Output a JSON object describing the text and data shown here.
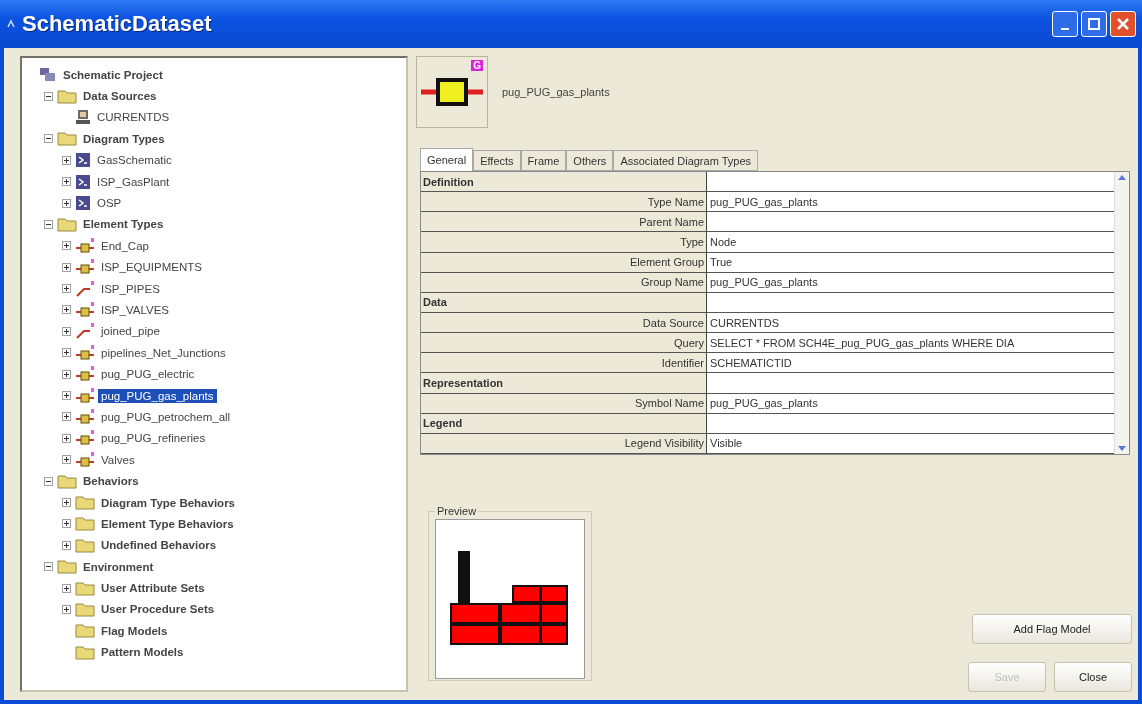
{
  "window": {
    "title": "SchematicDataset"
  },
  "tree": [
    {
      "label": "Schematic Project",
      "kind": "project",
      "selected": false,
      "children": [
        {
          "label": "Data Sources",
          "kind": "category",
          "expanded": true,
          "selected": false,
          "children": [
            {
              "label": "CURRENTDS",
              "kind": "datasource",
              "selected": false
            }
          ]
        },
        {
          "label": "Diagram Types",
          "kind": "category",
          "expanded": true,
          "selected": false,
          "children": [
            {
              "label": "GasSchematic",
              "kind": "diagram",
              "expanded": false,
              "selected": false
            },
            {
              "label": "ISP_GasPlant",
              "kind": "diagram",
              "expanded": false,
              "selected": false
            },
            {
              "label": "OSP",
              "kind": "diagram",
              "expanded": false,
              "selected": false
            }
          ]
        },
        {
          "label": "Element Types",
          "kind": "category",
          "expanded": true,
          "selected": false,
          "children": [
            {
              "label": "End_Cap",
              "kind": "node",
              "expanded": false,
              "selected": false
            },
            {
              "label": "ISP_EQUIPMENTS",
              "kind": "node",
              "expanded": false,
              "selected": false
            },
            {
              "label": "ISP_PIPES",
              "kind": "link",
              "expanded": false,
              "selected": false
            },
            {
              "label": "ISP_VALVES",
              "kind": "node",
              "expanded": false,
              "selected": false
            },
            {
              "label": "joined_pipe",
              "kind": "link",
              "expanded": false,
              "selected": false
            },
            {
              "label": "pipelines_Net_Junctions",
              "kind": "node",
              "expanded": false,
              "selected": false
            },
            {
              "label": "pug_PUG_electric",
              "kind": "node",
              "expanded": false,
              "selected": false
            },
            {
              "label": "pug_PUG_gas_plants",
              "kind": "node",
              "expanded": false,
              "selected": true
            },
            {
              "label": "pug_PUG_petrochem_all",
              "kind": "node",
              "expanded": false,
              "selected": false
            },
            {
              "label": "pug_PUG_refineries",
              "kind": "node",
              "expanded": false,
              "selected": false
            },
            {
              "label": "Valves",
              "kind": "node",
              "expanded": false,
              "selected": false
            }
          ]
        },
        {
          "label": "Behaviors",
          "kind": "category",
          "expanded": true,
          "selected": false,
          "children": [
            {
              "label": "Diagram Type Behaviors",
              "kind": "folder",
              "expanded": false,
              "selected": false
            },
            {
              "label": "Element Type Behaviors",
              "kind": "folder",
              "expanded": false,
              "selected": false
            },
            {
              "label": "Undefined Behaviors",
              "kind": "folder",
              "expanded": false,
              "selected": false
            }
          ]
        },
        {
          "label": "Environment",
          "kind": "category",
          "expanded": true,
          "selected": false,
          "children": [
            {
              "label": "User Attribute Sets",
              "kind": "folder",
              "expanded": false,
              "selected": false
            },
            {
              "label": "User Procedure Sets",
              "kind": "folder",
              "expanded": false,
              "selected": false
            },
            {
              "label": "Flag Models",
              "kind": "folder",
              "selected": false
            },
            {
              "label": "Pattern Models",
              "kind": "folder",
              "selected": false
            }
          ]
        }
      ]
    }
  ],
  "header": {
    "badge": "G",
    "name": "pug_PUG_gas_plants"
  },
  "tabs": [
    {
      "label": "General",
      "selected": true
    },
    {
      "label": "Effects",
      "selected": false
    },
    {
      "label": "Frame",
      "selected": false
    },
    {
      "label": "Others",
      "selected": false
    },
    {
      "label": "Associated Diagram Types",
      "selected": false
    }
  ],
  "properties": [
    {
      "kind": "section",
      "label": "Definition"
    },
    {
      "kind": "property",
      "label": "Type Name",
      "value": "pug_PUG_gas_plants"
    },
    {
      "kind": "property",
      "label": "Parent Name"
    },
    {
      "kind": "property",
      "label": "Type",
      "value": "Node"
    },
    {
      "kind": "property",
      "label": "Element Group",
      "value": "True"
    },
    {
      "kind": "property",
      "label": "Group Name",
      "value": "pug_PUG_gas_plants"
    },
    {
      "kind": "section",
      "label": "Data"
    },
    {
      "kind": "property",
      "label": "Data Source",
      "value": "CURRENTDS"
    },
    {
      "kind": "property",
      "label": "Query",
      "value": "SELECT * FROM SCH4E_pug_PUG_gas_plants WHERE DIA"
    },
    {
      "kind": "property",
      "label": "Identifier",
      "value": "SCHEMATICTID"
    },
    {
      "kind": "section",
      "label": "Representation"
    },
    {
      "kind": "property",
      "label": "Symbol Name",
      "value": "pug_PUG_gas_plants"
    },
    {
      "kind": "section",
      "label": "Legend"
    },
    {
      "kind": "property",
      "label": "Legend Visibility",
      "value": "Visible"
    }
  ],
  "preview": {
    "title": "Preview"
  },
  "buttons": [
    {
      "label": "Add Flag Model",
      "disabled": false
    },
    {
      "label": "Save",
      "disabled": true
    },
    {
      "label": "Close",
      "disabled": false
    }
  ]
}
